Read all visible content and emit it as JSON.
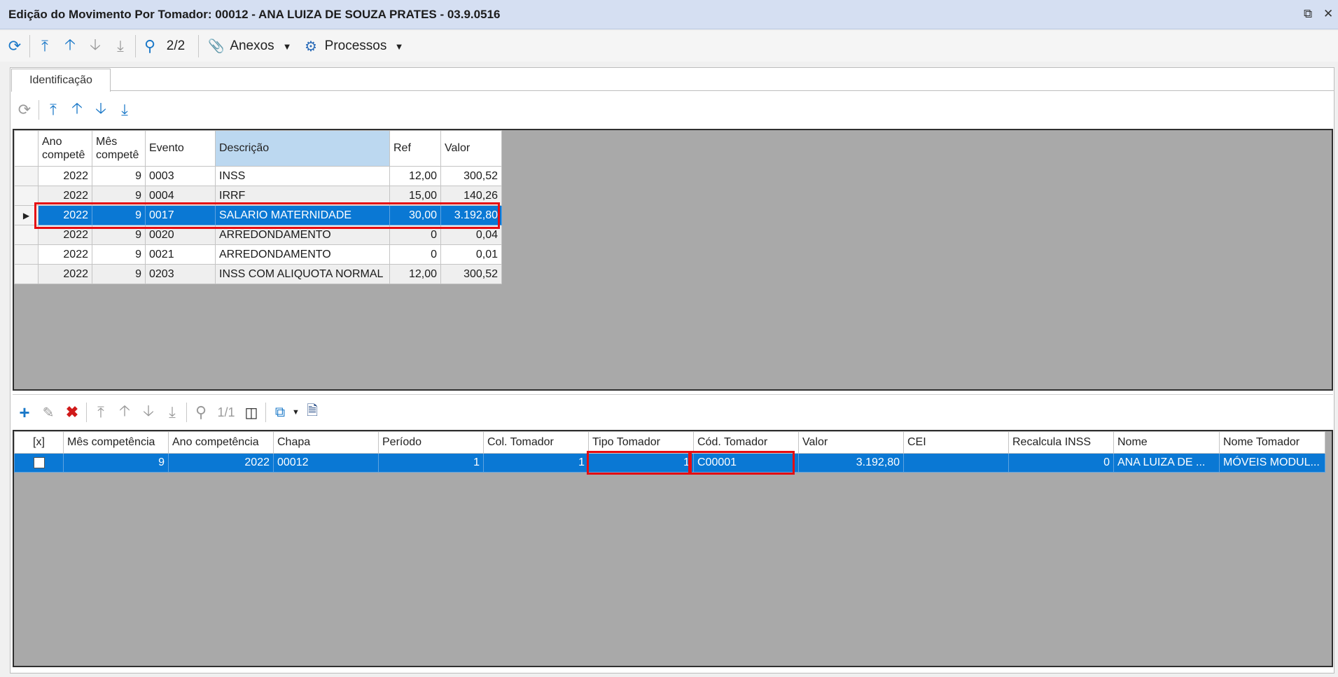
{
  "window": {
    "title": "Edição do Movimento Por Tomador: 00012 - ANA LUIZA  DE SOUZA PRATES - 03.9.0516",
    "restore_icon": "restore-icon",
    "close_icon": "close-icon"
  },
  "toolbar": {
    "record_counter": "2/2",
    "anexos_label": "Anexos",
    "processos_label": "Processos"
  },
  "tabs": [
    {
      "label": "Identificação"
    }
  ],
  "events_grid": {
    "columns": [
      "Ano competê",
      "Mês competê",
      "Evento",
      "Descrição",
      "Ref",
      "Valor"
    ],
    "column_lines": [
      [
        "Ano",
        "competê"
      ],
      [
        "Mês",
        "competê"
      ]
    ],
    "rows": [
      {
        "ano": "2022",
        "mes": "9",
        "evento": "0003",
        "descricao": "INSS",
        "ref": "12,00",
        "valor": "300,52"
      },
      {
        "ano": "2022",
        "mes": "9",
        "evento": "0004",
        "descricao": "IRRF",
        "ref": "15,00",
        "valor": "140,26"
      },
      {
        "ano": "2022",
        "mes": "9",
        "evento": "0017",
        "descricao": "SALARIO MATERNIDADE",
        "ref": "30,00",
        "valor": "3.192,80"
      },
      {
        "ano": "2022",
        "mes": "9",
        "evento": "0020",
        "descricao": "ARREDONDAMENTO",
        "ref": "0",
        "valor": "0,04"
      },
      {
        "ano": "2022",
        "mes": "9",
        "evento": "0021",
        "descricao": "ARREDONDAMENTO",
        "ref": "0",
        "valor": "0,01"
      },
      {
        "ano": "2022",
        "mes": "9",
        "evento": "0203",
        "descricao": "INSS COM ALIQUOTA NORMAL",
        "ref": "12,00",
        "valor": "300,52"
      }
    ]
  },
  "tomador_toolbar": {
    "record_counter": "1/1"
  },
  "tomador_grid": {
    "columns": [
      "[x]",
      "Mês competência",
      "Ano competência",
      "Chapa",
      "Período",
      "Col. Tomador",
      "Tipo Tomador",
      "Cód. Tomador",
      "Valor",
      "CEI",
      "Recalcula INSS",
      "Nome",
      "Nome Tomador"
    ],
    "rows": [
      {
        "mes": "9",
        "ano": "2022",
        "chapa": "00012",
        "periodo": "1",
        "col_tomador": "1",
        "tipo_tomador": "1",
        "cod_tomador": "C00001",
        "valor": "3.192,80",
        "cei": "",
        "recalcula_inss": "0",
        "nome": "ANA LUIZA  DE ...",
        "nome_tomador": "MÓVEIS MODUL..."
      }
    ]
  },
  "colors": {
    "accent": "#1a78c8",
    "selection": "#0a78d4",
    "highlight_box": "#e50d12",
    "grid_bg": "#a9a9a9"
  }
}
